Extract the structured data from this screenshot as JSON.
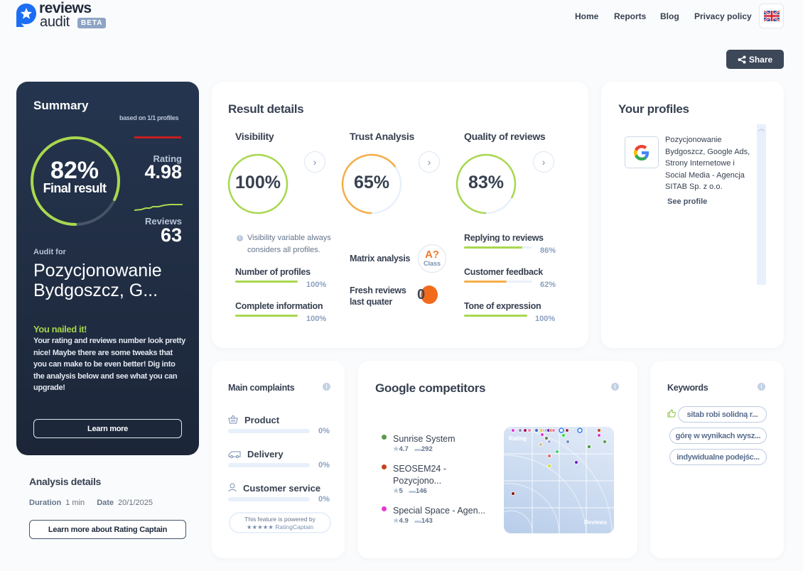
{
  "header": {
    "logo_top": "reviews",
    "logo_bottom": "audit",
    "beta": "BETA",
    "nav": [
      "Home",
      "Reports",
      "Blog",
      "Privacy policy"
    ],
    "language": "English (UK flag)",
    "share_label": "Share"
  },
  "summary": {
    "title": "Summary",
    "based_on": "based on 1/1 profiles",
    "final_result_pct": "82%",
    "final_result_value": 82,
    "final_result_label": "Final result",
    "rating_label": "Rating",
    "rating_value": "4.98",
    "reviews_label": "Reviews",
    "reviews_value": "63",
    "audit_for_label": "Audit for",
    "audit_name": "Pozycjonowanie Bydgoszcz, G...",
    "verdict_title": "You nailed it!",
    "verdict_text": "Your rating and reviews number look pretty nice! Maybe there are some tweaks that you can make to be even better! Dig into the analysis below and see what you can upgrade!",
    "learn_more": "Learn more"
  },
  "analysis_details": {
    "title": "Analysis details",
    "duration_label": "Duration",
    "duration_value": "1 min",
    "date_label": "Date",
    "date_value": "20/1/2025",
    "button": "Learn more about Rating Captain"
  },
  "result_details": {
    "title": "Result details",
    "visibility": {
      "title": "Visibility",
      "pct": "100%",
      "value": 100,
      "note": "Visibility variable always considers all profiles.",
      "metrics": [
        {
          "label": "Number of profiles",
          "pct": "100%",
          "value": 100
        },
        {
          "label": "Complete information",
          "pct": "100%",
          "value": 100
        }
      ]
    },
    "trust": {
      "title": "Trust Analysis",
      "pct": "65%",
      "value": 65,
      "matrix_label": "Matrix analysis",
      "matrix_class": "A?",
      "matrix_class_label": "Class",
      "fresh_label": "Fresh reviews last quater",
      "fresh_value": "0"
    },
    "quality": {
      "title": "Quality of reviews",
      "pct": "83%",
      "value": 83,
      "metrics": [
        {
          "label": "Replying to reviews",
          "pct": "86%",
          "value": 86
        },
        {
          "label": "Customer feedback",
          "pct": "62%",
          "value": 62
        },
        {
          "label": "Tone of expression",
          "pct": "100%",
          "value": 100
        }
      ]
    }
  },
  "profiles": {
    "title": "Your profiles",
    "items": [
      {
        "platform": "google-icon",
        "name": "Pozycjonowanie Bydgoszcz, Google Ads, Strony Internetowe i Social Media - Agencja SITAB Sp. z o.o.",
        "link": "See profile"
      }
    ]
  },
  "complaints": {
    "title": "Main complaints",
    "items": [
      {
        "label": "Product",
        "pct": "0%",
        "icon": "basket-icon"
      },
      {
        "label": "Delivery",
        "pct": "0%",
        "icon": "truck-icon"
      },
      {
        "label": "Customer service",
        "pct": "0%",
        "icon": "person-icon"
      }
    ],
    "powered_line1": "This feature is powered by",
    "powered_line2": "★★★★★ RatingCaptain"
  },
  "competitors": {
    "title": "Google competitors",
    "items": [
      {
        "name": "Sunrise System",
        "rating": "4.7",
        "reviews": "292",
        "color": "#5a9a4a"
      },
      {
        "name": "SEOSEM24 - Pozycjono...",
        "rating": "5",
        "reviews": "146",
        "color": "#c4441c"
      },
      {
        "name": "Special Space - Agen...",
        "rating": "4.9",
        "reviews": "143",
        "color": "#e03ad8"
      }
    ],
    "chart_axis_y": "Rating",
    "chart_axis_x": "Reviews"
  },
  "keywords": {
    "title": "Keywords",
    "items": [
      "sitab robi solidną r...",
      "górę w wynikach wysz...",
      "indywidualne podejśc..."
    ]
  },
  "colors": {
    "accent_green": "#a8d84e",
    "accent_orange": "#f6ad47",
    "dark_panel": "#23324a"
  }
}
